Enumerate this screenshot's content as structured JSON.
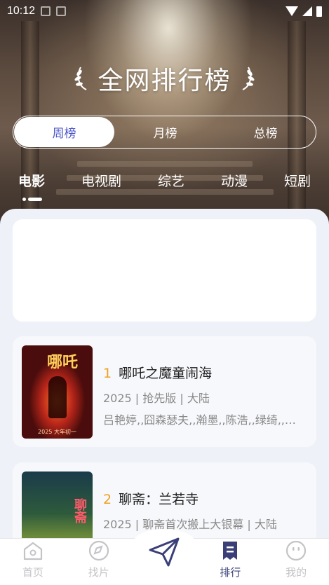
{
  "status_bar": {
    "time": "10:12",
    "icons": [
      "notification-a-icon",
      "notification-b-icon",
      "wifi-icon",
      "signal-icon",
      "battery-icon"
    ]
  },
  "header": {
    "title": "全网排行榜"
  },
  "period_tabs": [
    {
      "label": "周榜",
      "active": true
    },
    {
      "label": "月榜",
      "active": false
    },
    {
      "label": "总榜",
      "active": false
    }
  ],
  "category_tabs": [
    {
      "label": "电影",
      "active": true
    },
    {
      "label": "电视剧",
      "active": false
    },
    {
      "label": "综艺",
      "active": false
    },
    {
      "label": "动漫",
      "active": false
    },
    {
      "label": "短剧",
      "active": false
    }
  ],
  "movies": [
    {
      "rank": "1",
      "title": "哪吒之魔童闹海",
      "meta": "2025 | 抢先版 | 大陆",
      "cast": "吕艳婷,,囧森瑟夫,,瀚墨,,陈浩,,绿绮,,张珈铭,,杨卫",
      "poster_text": "哪吒",
      "poster_foot": "2025 大年初一"
    },
    {
      "rank": "2",
      "title": "聊斋：兰若寺",
      "meta": "2025 | 聊斋首次搬上大银幕 | 大陆",
      "cast": "",
      "poster_text": "聊斋"
    }
  ],
  "bottom_nav": [
    {
      "label": "首页",
      "icon": "home-icon",
      "active": false
    },
    {
      "label": "找片",
      "icon": "compass-icon",
      "active": false
    },
    {
      "label": "",
      "icon": "paper-plane-icon",
      "active": false
    },
    {
      "label": "排行",
      "icon": "ranking-icon",
      "active": true
    },
    {
      "label": "我的",
      "icon": "profile-icon",
      "active": false
    }
  ],
  "colors": {
    "accent": "#4a55c8",
    "rank": "#f0a020",
    "nav_active": "#3a3f78"
  }
}
